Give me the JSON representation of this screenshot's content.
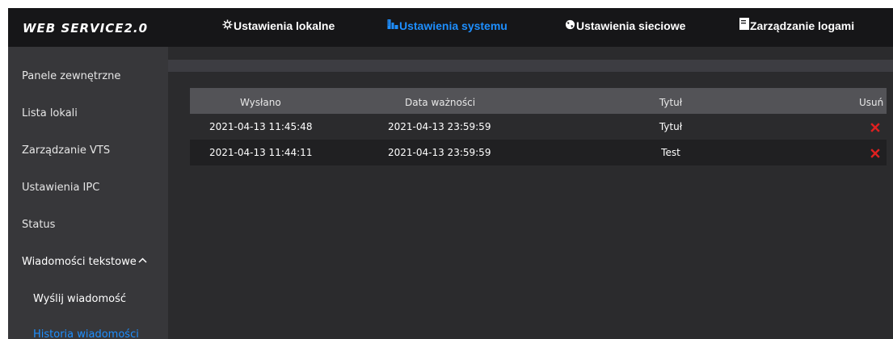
{
  "header": {
    "brand": "WEB SERVICE2.0",
    "nav": [
      {
        "label": "Ustawienia lokalne"
      },
      {
        "label": "Ustawienia systemu"
      },
      {
        "label": "Ustawienia sieciowe"
      },
      {
        "label": "Zarządzanie logami"
      }
    ]
  },
  "sidebar": {
    "items": [
      {
        "label": "Panele zewnętrzne"
      },
      {
        "label": "Lista lokali"
      },
      {
        "label": "Zarządzanie VTS"
      },
      {
        "label": "Ustawienia IPC"
      },
      {
        "label": "Status"
      },
      {
        "label": "Wiadomości tekstowe"
      },
      {
        "label": "Wyślij wiadomość"
      },
      {
        "label": "Historia wiadomości"
      }
    ]
  },
  "table": {
    "headers": {
      "sent": "Wysłano",
      "expiry": "Data ważności",
      "title": "Tytuł",
      "delete": "Usuń"
    },
    "rows": [
      {
        "sent": "2021-04-13 11:45:48",
        "expiry": "2021-04-13 23:59:59",
        "title": "Tytuł"
      },
      {
        "sent": "2021-04-13 11:44:11",
        "expiry": "2021-04-13 23:59:59",
        "title": "Test"
      }
    ]
  },
  "colors": {
    "accent": "#1e8fff",
    "delete": "#e02020",
    "background": "#2b2b2d"
  },
  "icons": [
    "gear-icon",
    "building-icon",
    "globe-icon",
    "log-icon",
    "chevron-up-icon",
    "close-icon"
  ]
}
